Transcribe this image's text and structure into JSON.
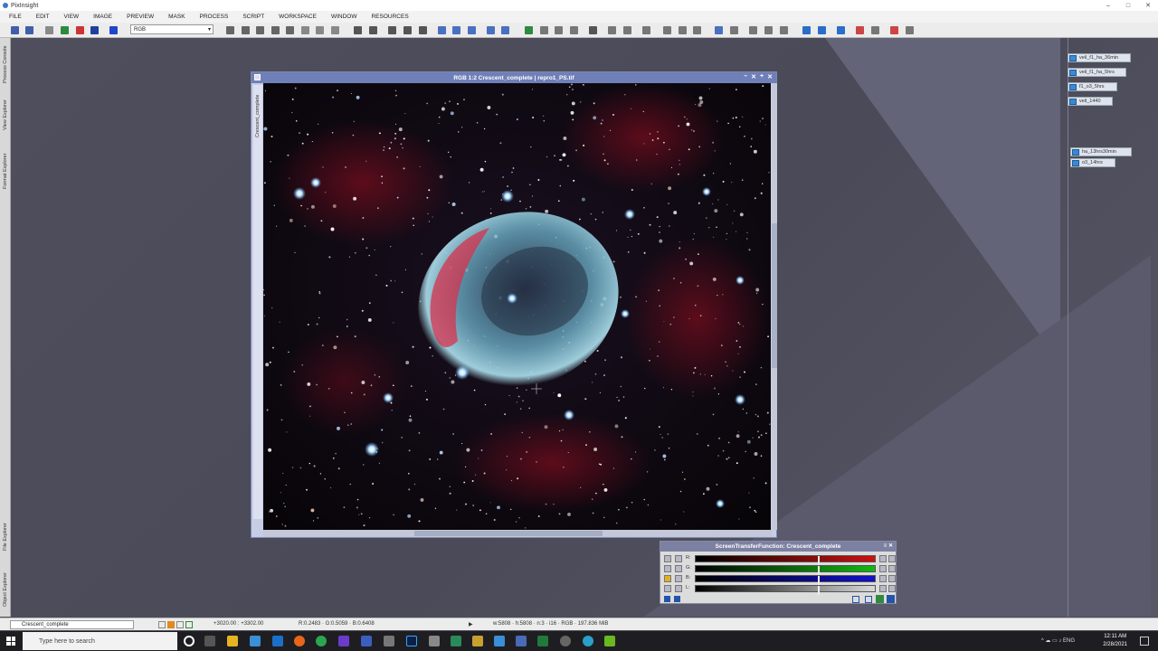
{
  "window": {
    "app_title": "PixInsight",
    "minimize": "–",
    "maximize": "□",
    "close": "✕"
  },
  "menu": [
    "FILE",
    "EDIT",
    "VIEW",
    "IMAGE",
    "PREVIEW",
    "MASK",
    "PROCESS",
    "SCRIPT",
    "WORKSPACE",
    "WINDOW",
    "RESOURCES"
  ],
  "toolbar": {
    "channel_select": "RGB",
    "dropdown_arrow": "▾"
  },
  "left_tabs": [
    "Process Console",
    "View Explorer",
    "Format Explorer",
    "File Explorer",
    "Object Explorer"
  ],
  "image_window": {
    "title": "RGB 1:2 Crescent_complete | repro1_PS.tif",
    "side_label": "Crescent_complete",
    "controls": [
      "–",
      "✕",
      "+",
      "✕"
    ]
  },
  "icons": [
    {
      "label": "veil_f1_ha_36min"
    },
    {
      "label": "veil_f1_ha_5hrs"
    },
    {
      "label": "f1_o3_5hrs"
    },
    {
      "label": "veil_1440"
    },
    {
      "label": "ha_13hrs30min"
    },
    {
      "label": "o3_14hrs"
    }
  ],
  "stf": {
    "title": "ScreenTransferFunction: Crescent_complete",
    "controls": "≡ ✕",
    "rows": [
      {
        "label": "R:",
        "color": "#cc1111"
      },
      {
        "label": "G:",
        "color": "#11bb11"
      },
      {
        "label": "B:",
        "color": "#1111cc"
      },
      {
        "label": "L:",
        "color": "#d8d8d8"
      }
    ]
  },
  "status": {
    "view": "Crescent_complete",
    "coords": "+3020.00 : +3302.00",
    "values": "R:0.2483 · G:0.5059 · B:0.6408",
    "play": "▶",
    "info": "w:5808 · h:5808 · n:3 · i16 · RGB · 197.836 MiB"
  },
  "taskbar": {
    "search_placeholder": "Type here to search",
    "time": "12:11 AM",
    "date": "2/28/2021",
    "tray": "^  ☁  ▭  ♪  ENG"
  }
}
